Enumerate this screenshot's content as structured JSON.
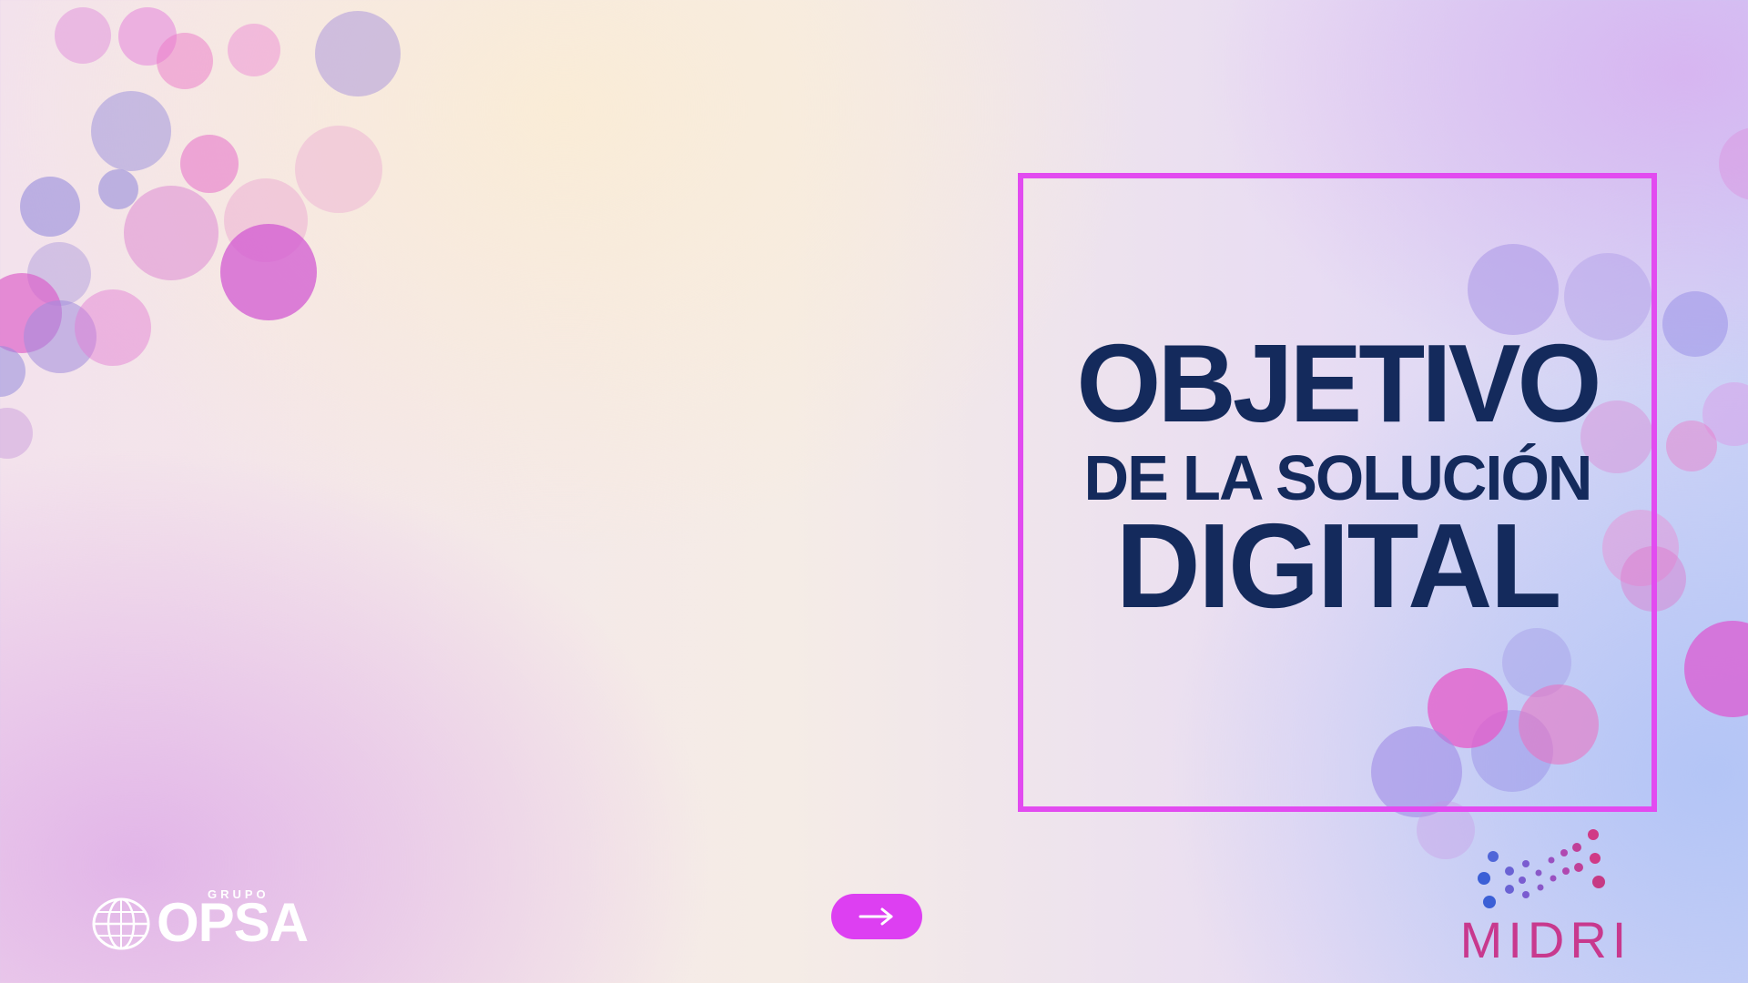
{
  "slide": {
    "title_line1": "OBJETIVO",
    "title_line2": "DE LA SOLUCIÓN",
    "title_line3": "DIGITAL"
  },
  "navigation": {
    "next_icon": "arrow-right-icon"
  },
  "logos": {
    "left_brand_small": "GRUPO",
    "left_brand_main": "OPSA",
    "right_brand": "MIDRI"
  },
  "colors": {
    "accent_magenta": "#e24bf0",
    "title_navy": "#142a5c",
    "button_fill": "#dd3ff2",
    "midri_text": "#c8398e"
  }
}
